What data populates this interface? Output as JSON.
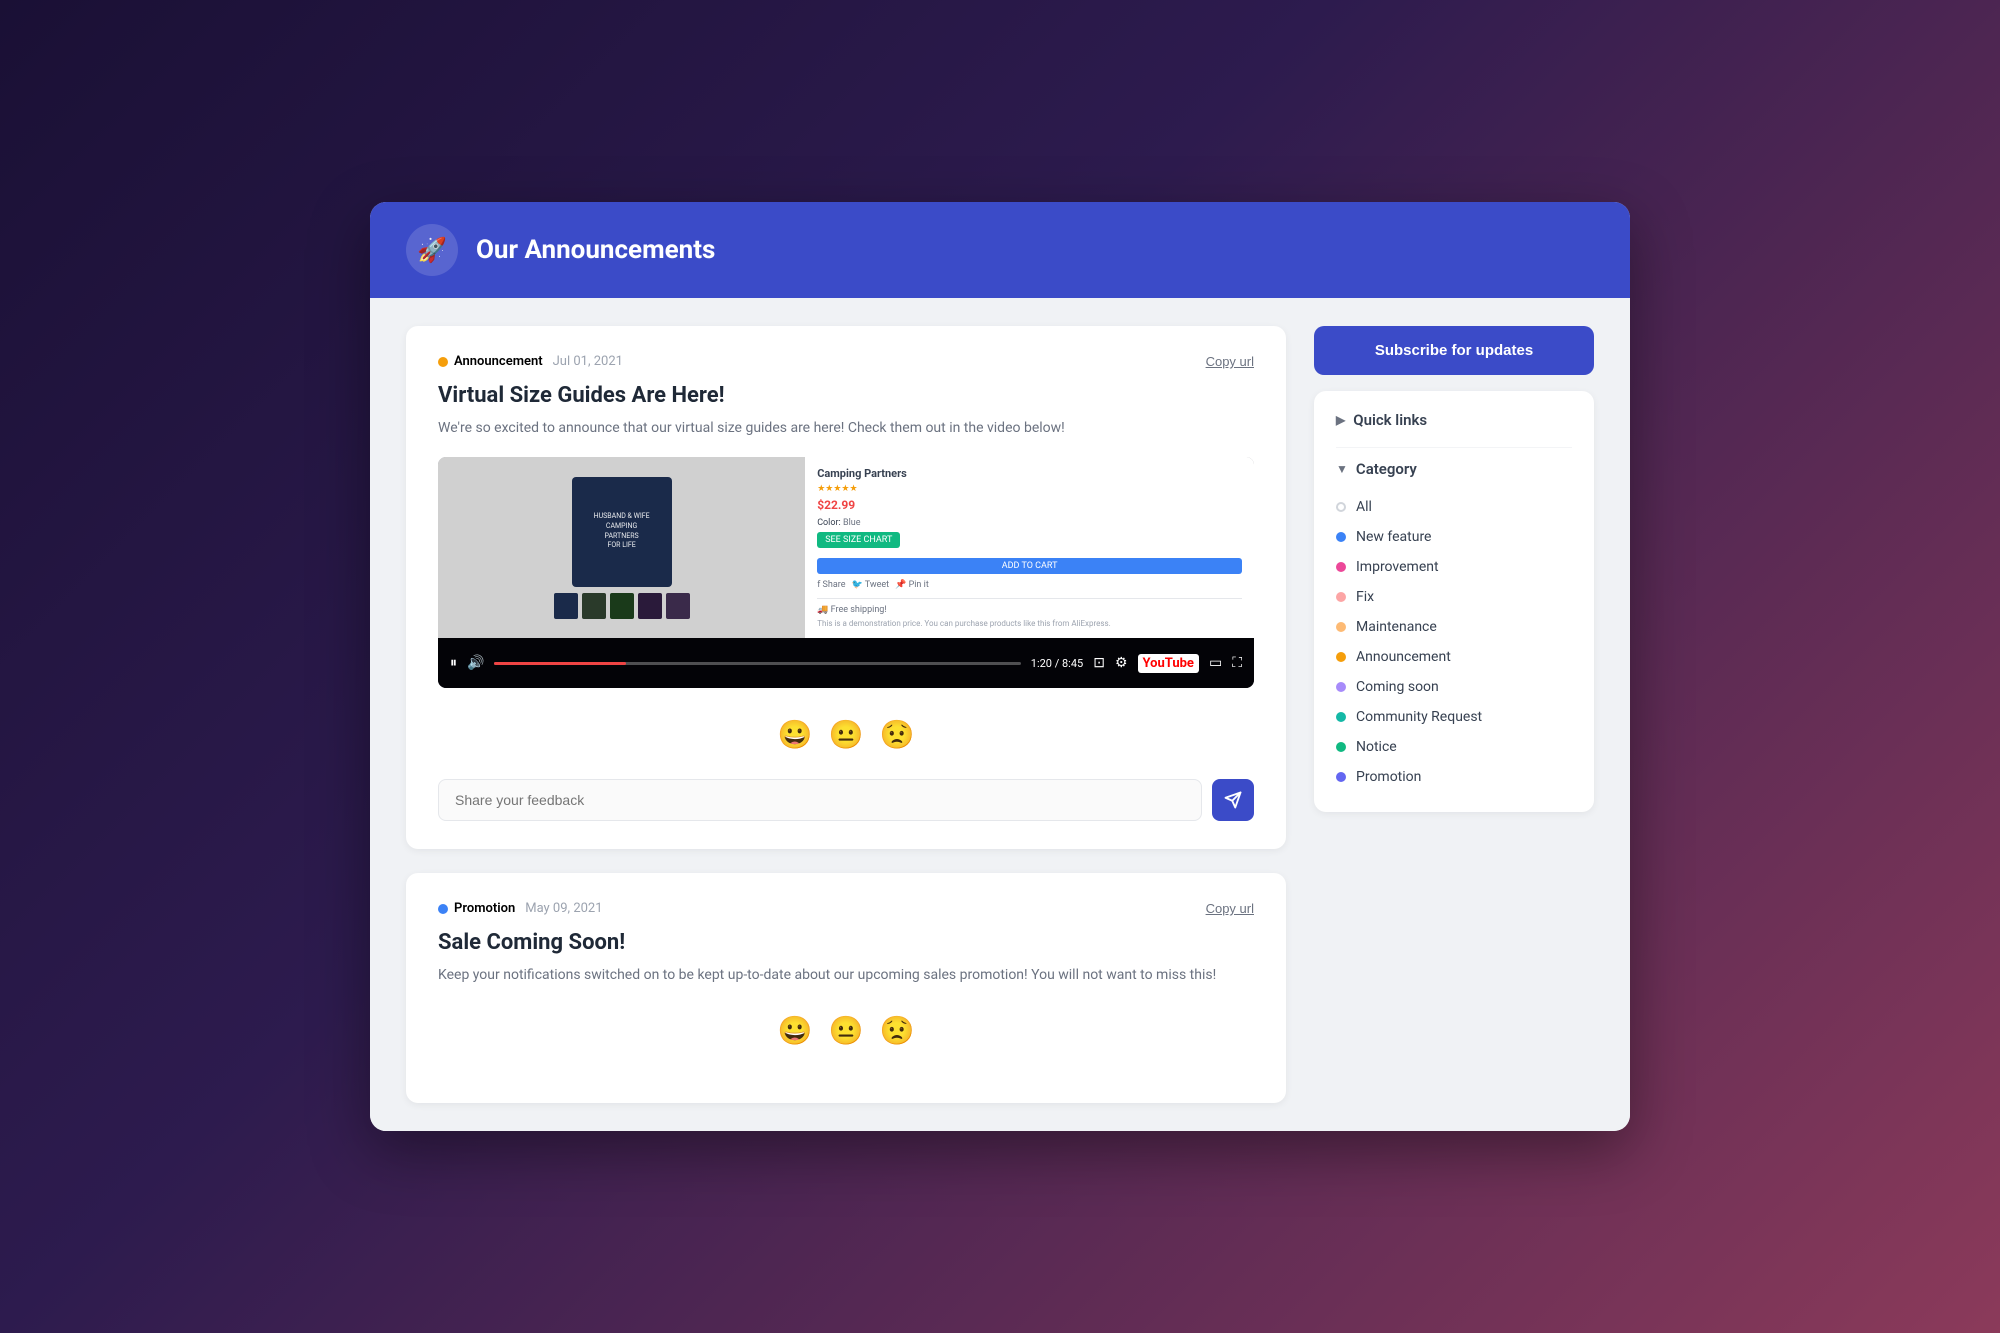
{
  "header": {
    "logo_icon": "🚀",
    "title": "Our Announcements"
  },
  "posts": [
    {
      "id": "post-1",
      "tag": "Announcement",
      "tag_color": "orange",
      "date": "Jul 01, 2021",
      "copy_url_label": "Copy url",
      "title": "Virtual Size Guides Are Here!",
      "description": "We're so excited to announce that our virtual size guides are here! Check them out in the video below!",
      "has_video": true,
      "video_time": "1:20 / 8:45",
      "emojis": [
        "😀",
        "😐",
        "😟"
      ],
      "feedback_placeholder": "Share your feedback"
    },
    {
      "id": "post-2",
      "tag": "Promotion",
      "tag_color": "blue",
      "date": "May 09, 2021",
      "copy_url_label": "Copy url",
      "title": "Sale Coming Soon!",
      "description": "Keep your notifications switched on to be kept up-to-date about our upcoming sales promotion! You will not want to miss this!",
      "has_video": false
    }
  ],
  "sidebar": {
    "subscribe_button_label": "Subscribe for updates",
    "quick_links_label": "Quick links",
    "category_label": "Category",
    "categories": [
      {
        "name": "All",
        "dot_type": "all"
      },
      {
        "name": "New feature",
        "dot_class": "dot-blue"
      },
      {
        "name": "Improvement",
        "dot_class": "dot-pink"
      },
      {
        "name": "Fix",
        "dot_class": "dot-red-light"
      },
      {
        "name": "Maintenance",
        "dot_class": "dot-peach"
      },
      {
        "name": "Announcement",
        "dot_class": "dot-orange"
      },
      {
        "name": "Coming soon",
        "dot_class": "dot-lavender"
      },
      {
        "name": "Community Request",
        "dot_class": "dot-teal"
      },
      {
        "name": "Notice",
        "dot_class": "dot-green"
      },
      {
        "name": "Promotion",
        "dot_class": "dot-indigo"
      }
    ]
  },
  "product": {
    "name": "Camping Partners",
    "price": "$22.99",
    "shirt_text": "HUSBAND & WIFE\nCAMPING\nPARTNERS FOR LIFE"
  }
}
